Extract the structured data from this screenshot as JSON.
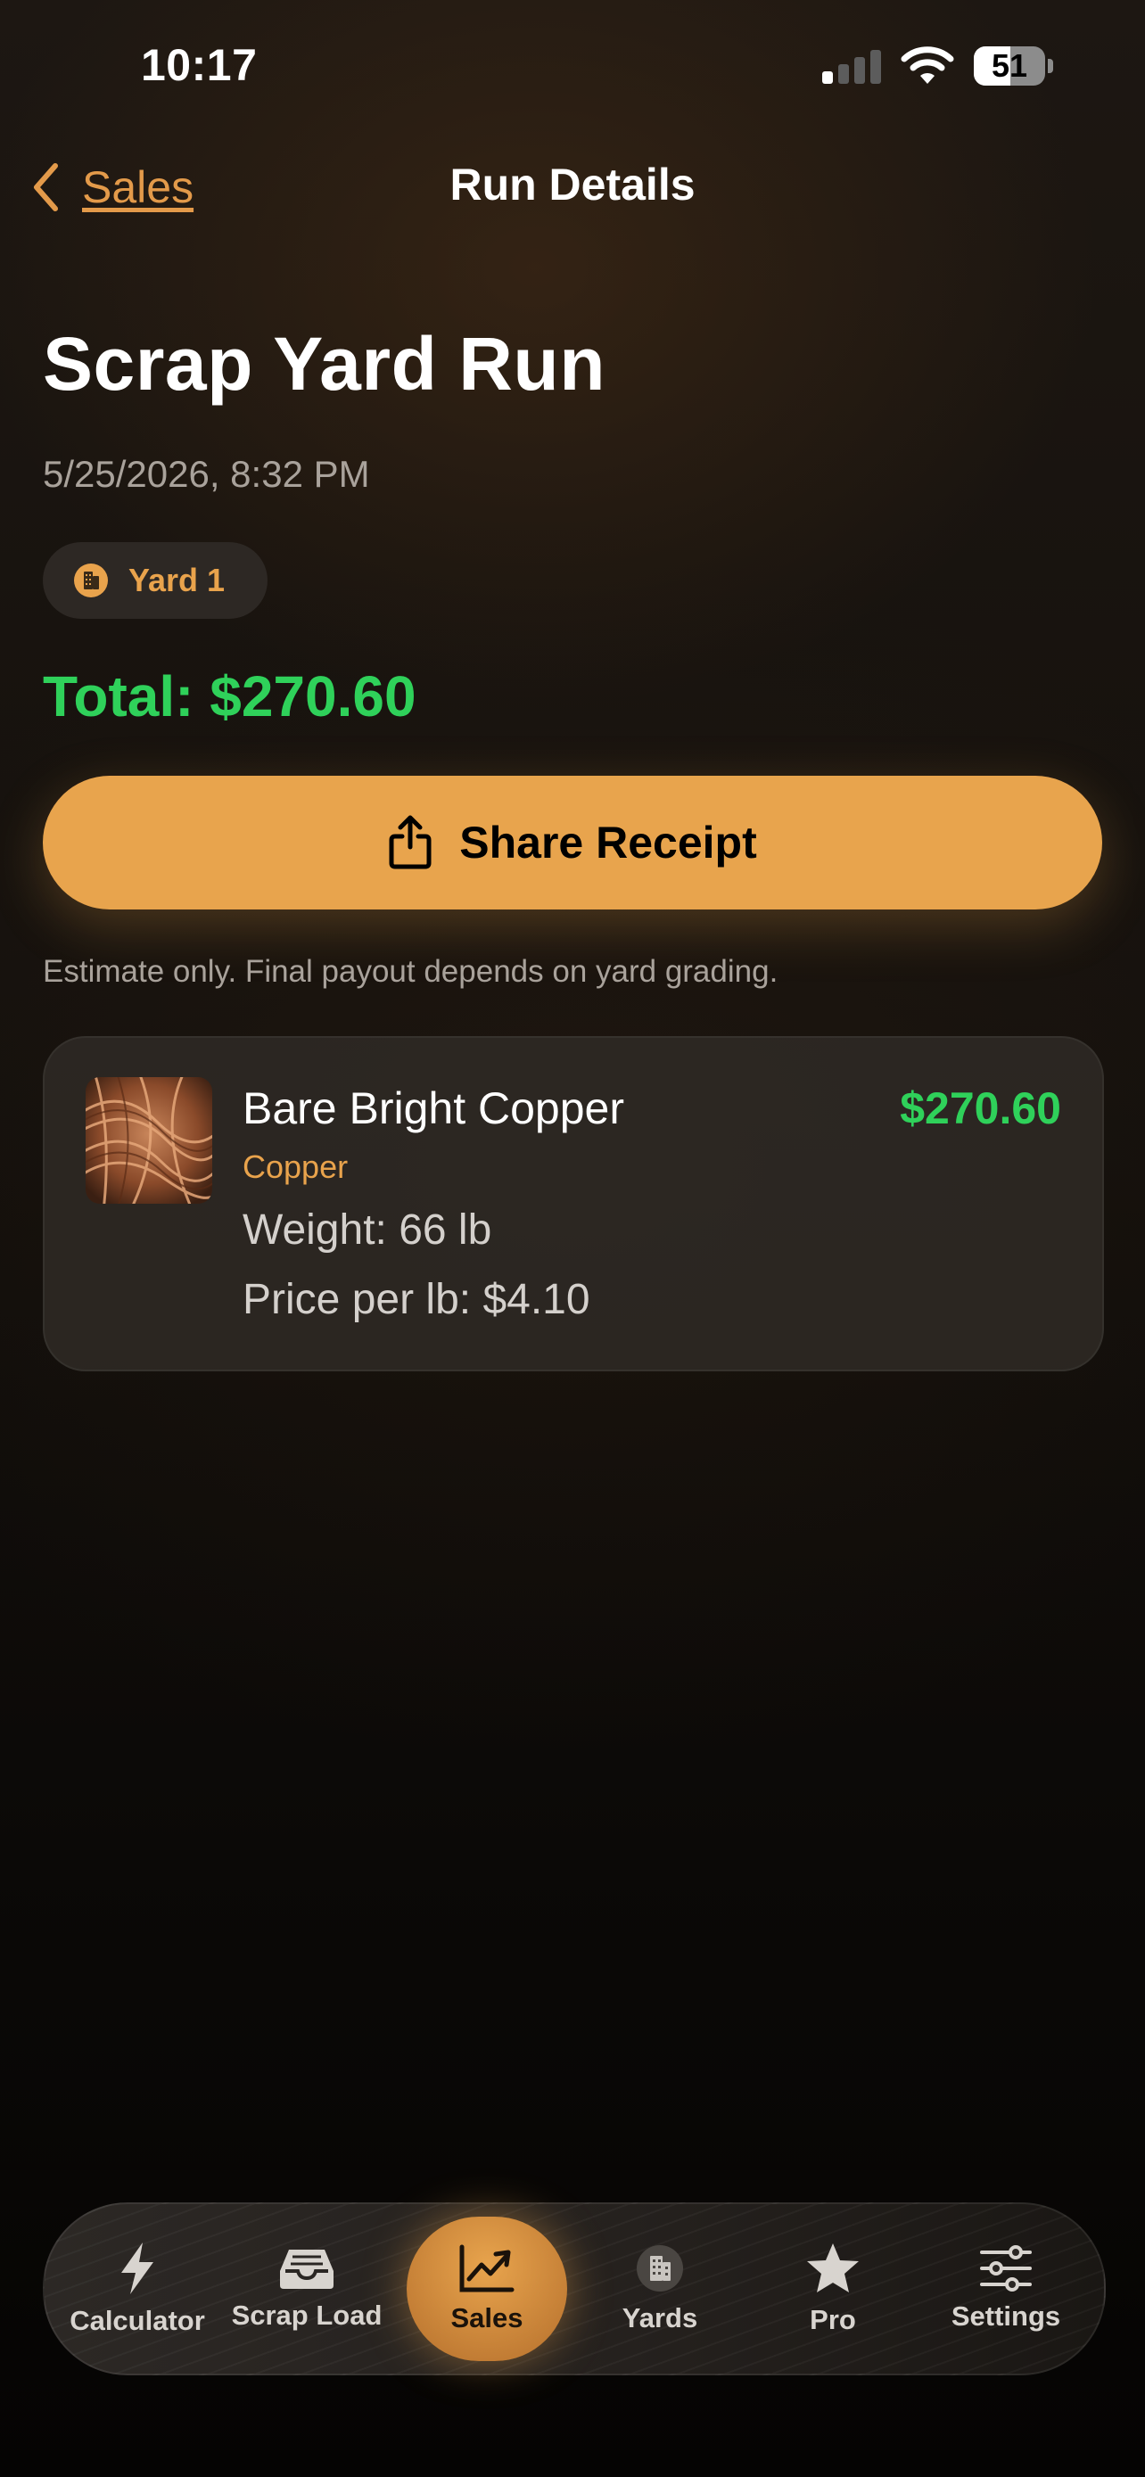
{
  "status_bar": {
    "time": "10:17",
    "battery": "51",
    "battery_level": 0.51
  },
  "nav": {
    "back_label": "Sales",
    "title": "Run Details"
  },
  "run": {
    "title": "Scrap Yard Run",
    "date": "5/25/2026, 8:32 PM",
    "yard": "Yard 1",
    "total": "Total: $270.60"
  },
  "share_button": {
    "label": "Share Receipt"
  },
  "disclaimer": "Estimate only. Final payout depends on yard grading.",
  "items": [
    {
      "name": "Bare Bright Copper",
      "category": "Copper",
      "price": "$270.60",
      "weight": "Weight: 66 lb",
      "price_per_lb": "Price per lb: $4.10"
    }
  ],
  "tabs": [
    {
      "label": "Calculator",
      "icon": "bolt-icon"
    },
    {
      "label": "Scrap Load",
      "icon": "tray-icon"
    },
    {
      "label": "Sales",
      "icon": "chart-icon",
      "active": true
    },
    {
      "label": "Yards",
      "icon": "building-icon"
    },
    {
      "label": "Pro",
      "icon": "star-icon"
    },
    {
      "label": "Settings",
      "icon": "sliders-icon"
    }
  ],
  "colors": {
    "accent": "#E8A44D",
    "green": "#2FD15A",
    "background": "#15110D"
  }
}
